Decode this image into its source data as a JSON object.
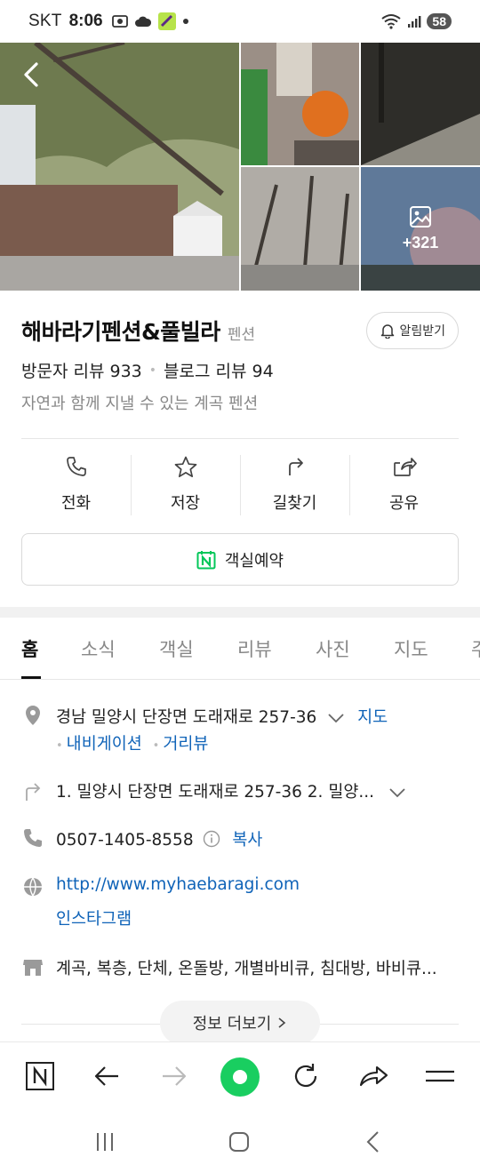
{
  "status_bar": {
    "carrier": "SKT",
    "time": "8:06",
    "battery": "58"
  },
  "gallery": {
    "photo_count_overlay": "+321"
  },
  "place": {
    "name": "해바라기펜션&풀빌라",
    "category": "펜션",
    "alarm_label": "알림받기",
    "visitor_review_label": "방문자 리뷰 933",
    "blog_review_label": "블로그 리뷰 94",
    "description": "자연과 함께 지낼 수 있는 계곡 펜션"
  },
  "actions": [
    {
      "label": "전화",
      "icon": "phone-icon"
    },
    {
      "label": "저장",
      "icon": "star-icon"
    },
    {
      "label": "길찾기",
      "icon": "directions-icon"
    },
    {
      "label": "공유",
      "icon": "share-icon"
    }
  ],
  "reserve": {
    "label": "객실예약"
  },
  "tabs": [
    {
      "label": "홈",
      "active": true
    },
    {
      "label": "소식",
      "active": false
    },
    {
      "label": "객실",
      "active": false
    },
    {
      "label": "리뷰",
      "active": false
    },
    {
      "label": "사진",
      "active": false
    },
    {
      "label": "지도",
      "active": false
    },
    {
      "label": "주",
      "active": false
    }
  ],
  "info": {
    "address": "경남 밀양시 단장면 도래재로 257-36",
    "map_link": "지도",
    "navigation_link": "내비게이션",
    "street_view_link": "거리뷰",
    "directions": "1. 밀양시 단장면 도래재로 257-36 2. 밀양...",
    "phone": "0507-1405-8558",
    "copy_link": "복사",
    "website": "http://www.myhaebaragi.com",
    "instagram": "인스타그램",
    "amenities": "계곡, 복층, 단체, 온돌방, 개별바비큐, 침대방, 바비큐..."
  },
  "more_info_label": "정보 더보기",
  "colors": {
    "link_blue": "#0f63b8",
    "naver_green": "#19ce60",
    "reserve_icon_green": "#03c75a"
  }
}
